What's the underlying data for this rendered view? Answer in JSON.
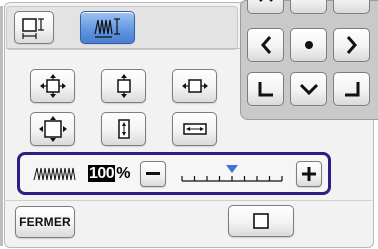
{
  "slider": {
    "percent_value": "100",
    "percent_unit": "%",
    "level_fraction": 0.5,
    "tick_count": 9
  },
  "footer": {
    "close_label": "FERMER"
  },
  "colors": {
    "selection_border": "#2a1f85",
    "active_tab": "#5f95e0",
    "slider_marker": "#3d74d4",
    "nav_pad_bg": "#c9c9c9"
  },
  "icons": {
    "tab_frame": "frame-size-icon",
    "tab_density": "fill-density-icon",
    "nav_up": "arrow-up-icon",
    "nav_left": "arrow-left-icon",
    "nav_center": "center-dot-icon",
    "nav_right": "arrow-right-icon",
    "nav_bottom_left": "corner-bottom-left-icon",
    "nav_down": "arrow-down-icon",
    "nav_bottom_right": "corner-bottom-right-icon",
    "density": "stitch-density-icon"
  }
}
